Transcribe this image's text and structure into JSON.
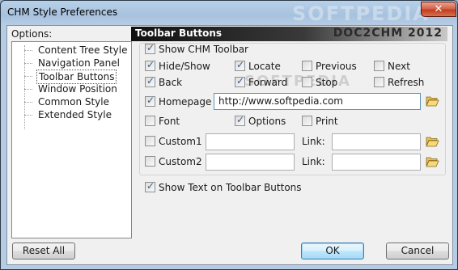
{
  "window": {
    "title": "CHM Style Preferences",
    "watermark": "SOFTPEDIA",
    "close_symbol": "✕"
  },
  "sidebar": {
    "label": "Options:",
    "items": [
      {
        "label": "Content Tree Style"
      },
      {
        "label": "Navigation Panel"
      },
      {
        "label": "Toolbar Buttons",
        "selected": true
      },
      {
        "label": "Window Position"
      },
      {
        "label": "Common Style"
      },
      {
        "label": "Extended Style"
      }
    ]
  },
  "panel": {
    "title": "Toolbar Buttons",
    "brand": "DOC2CHM 2012",
    "watermark": "SOFTPEDIA",
    "show_toolbar": {
      "label": "Show CHM Toolbar",
      "checked": true
    },
    "buttons": {
      "hide_show": {
        "label": "Hide/Show",
        "checked": true
      },
      "locate": {
        "label": "Locate",
        "checked": true
      },
      "previous": {
        "label": "Previous",
        "checked": false
      },
      "next": {
        "label": "Next",
        "checked": false
      },
      "back": {
        "label": "Back",
        "checked": true
      },
      "forward": {
        "label": "Forward",
        "checked": true
      },
      "stop": {
        "label": "Stop",
        "checked": false
      },
      "refresh": {
        "label": "Refresh",
        "checked": false
      },
      "homepage": {
        "label": "Homepage",
        "checked": true,
        "url": "http://www.softpedia.com"
      },
      "font": {
        "label": "Font",
        "checked": false
      },
      "options": {
        "label": "Options",
        "checked": true
      },
      "print": {
        "label": "Print",
        "checked": false
      },
      "custom1": {
        "label": "Custom1",
        "checked": false,
        "name": "",
        "link_label": "Link:",
        "link": ""
      },
      "custom2": {
        "label": "Custom2",
        "checked": false,
        "name": "",
        "link_label": "Link:",
        "link": ""
      }
    },
    "show_text": {
      "label": "Show Text on Toolbar Buttons",
      "checked": true
    }
  },
  "footer": {
    "reset_label": "Reset All",
    "ok_label": "OK",
    "cancel_label": "Cancel"
  },
  "colors": {
    "selection": "#3399ff",
    "checkmark": "#3c5d86"
  }
}
